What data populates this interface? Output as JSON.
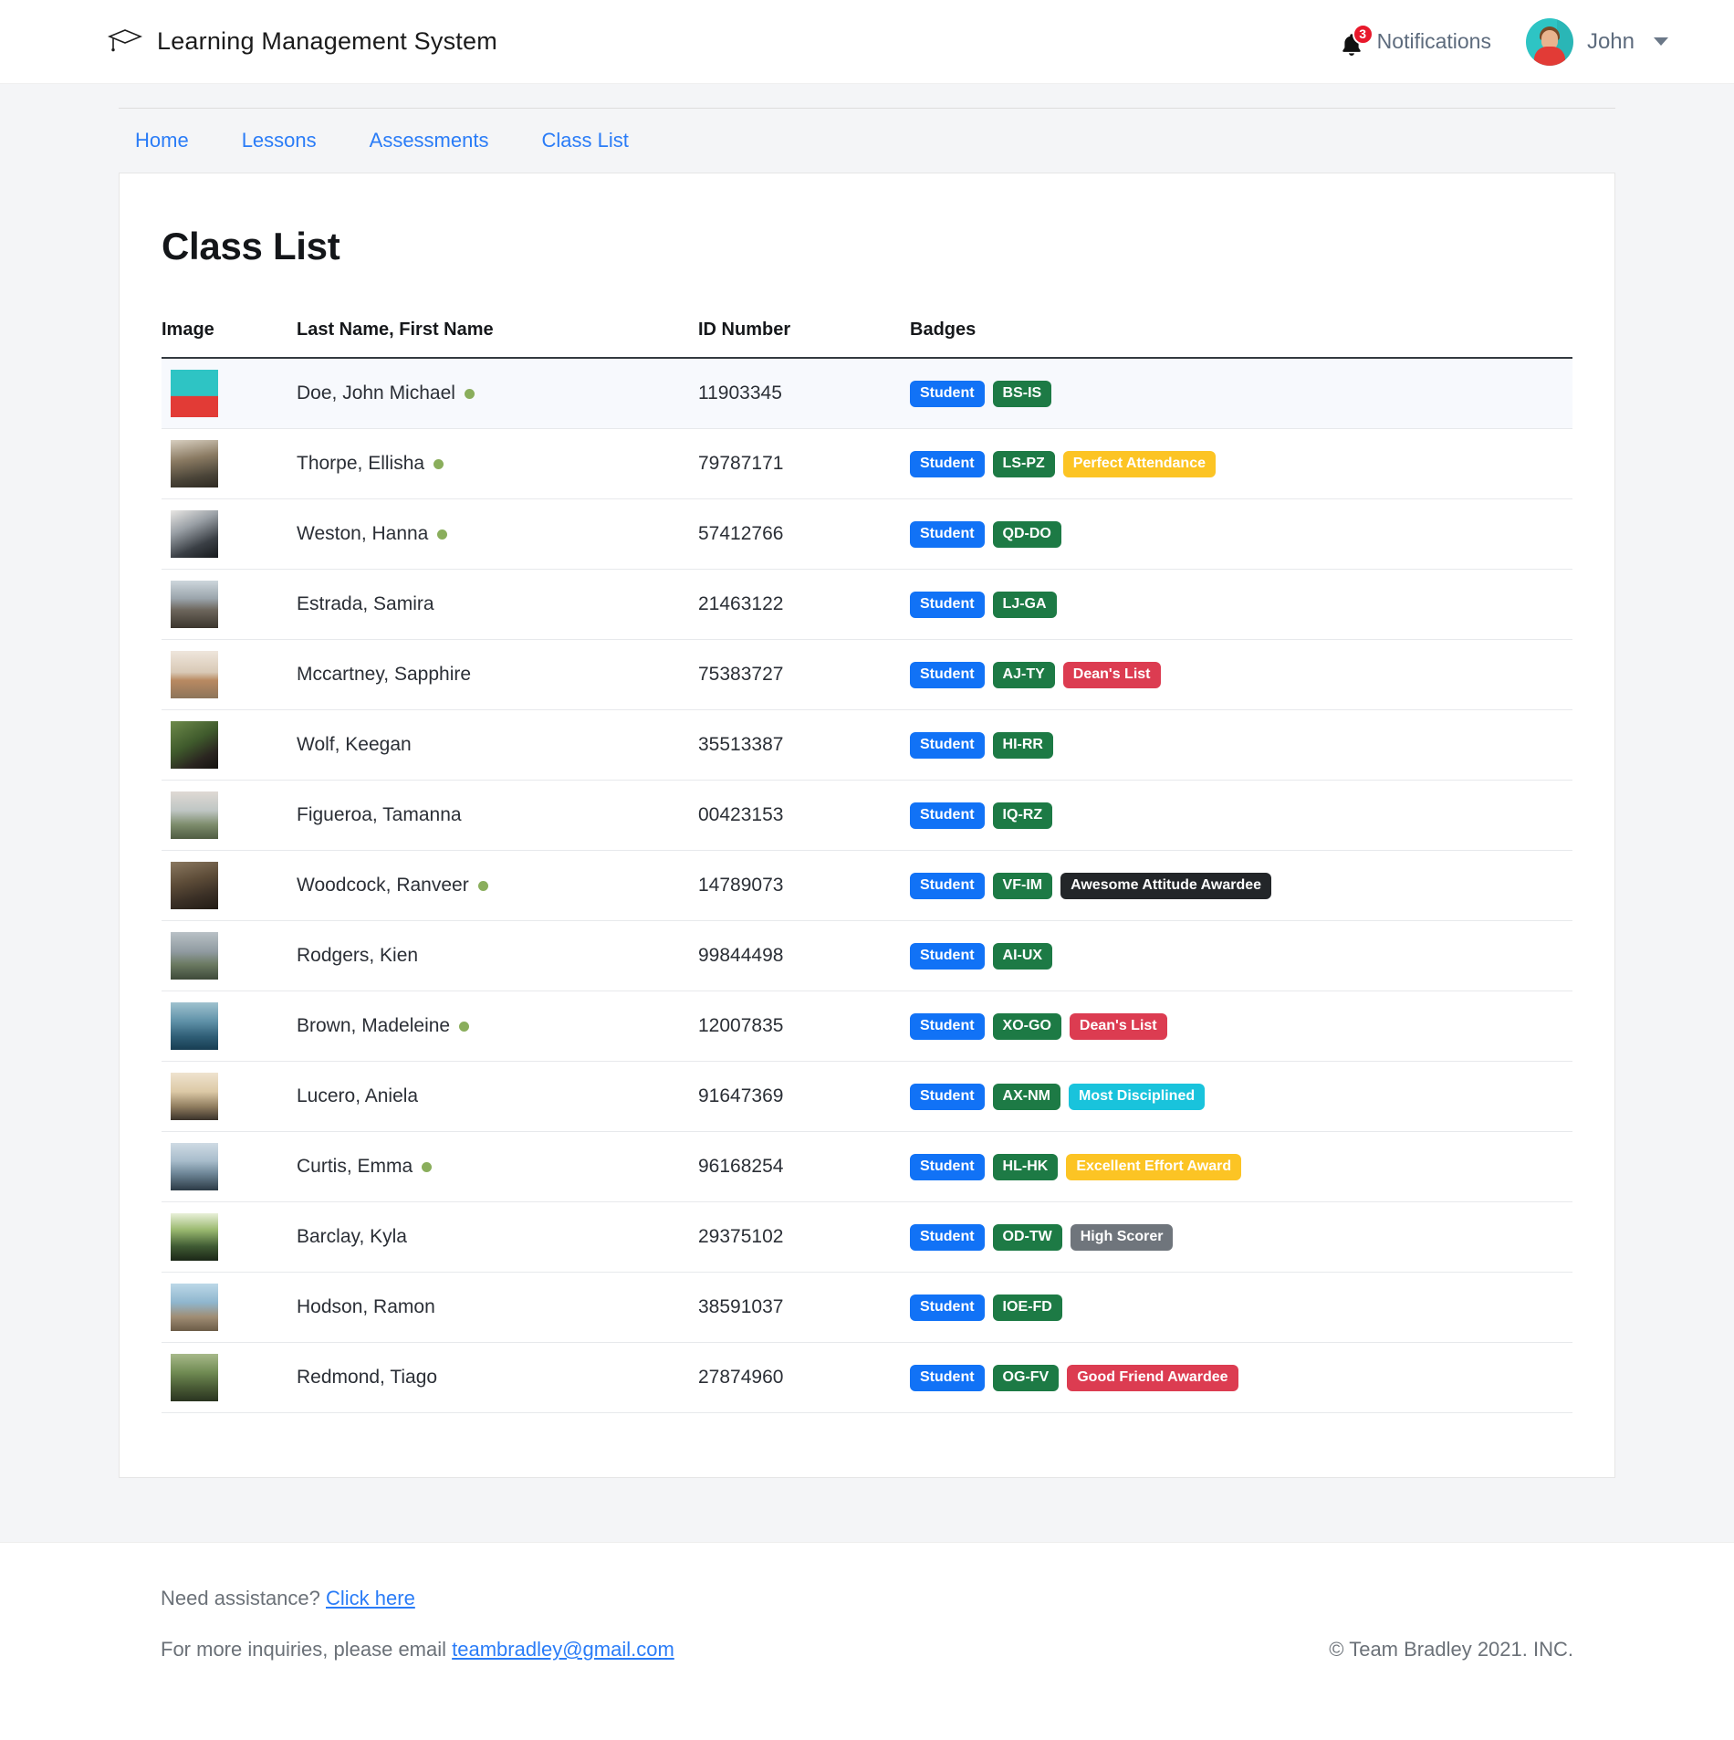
{
  "header": {
    "brand_title": "Learning Management System",
    "brand_icon": "graduation-cap-icon",
    "notifications": {
      "label": "Notifications",
      "count": "3",
      "icon": "bell-icon"
    },
    "user": {
      "name": "John",
      "avatar": "user-avatar",
      "caret": "chevron-down-icon"
    }
  },
  "subnav": {
    "items": [
      {
        "label": "Home"
      },
      {
        "label": "Lessons"
      },
      {
        "label": "Assessments"
      },
      {
        "label": "Class List"
      }
    ]
  },
  "main": {
    "page_title": "Class List",
    "table": {
      "columns": [
        "Image",
        "Last Name, First Name",
        "ID Number",
        "Badges"
      ],
      "rows": [
        {
          "name": "Doe, John Michael",
          "online": true,
          "id": "11903345",
          "highlight": true,
          "thumb": "avatar-john-thumb",
          "badges": [
            {
              "label": "Student",
              "color": "b-primary"
            },
            {
              "label": "BS-IS",
              "color": "b-green"
            }
          ]
        },
        {
          "name": "Thorpe, Ellisha",
          "online": true,
          "id": "79787171",
          "highlight": false,
          "thumb": "alleyway-thumb",
          "badges": [
            {
              "label": "Student",
              "color": "b-primary"
            },
            {
              "label": "LS-PZ",
              "color": "b-green"
            },
            {
              "label": "Perfect Attendance",
              "color": "b-yellow"
            }
          ]
        },
        {
          "name": "Weston, Hanna",
          "online": true,
          "id": "57412766",
          "highlight": false,
          "thumb": "laptop-thumb",
          "badges": [
            {
              "label": "Student",
              "color": "b-primary"
            },
            {
              "label": "QD-DO",
              "color": "b-green"
            }
          ]
        },
        {
          "name": "Estrada, Samira",
          "online": false,
          "id": "21463122",
          "highlight": false,
          "thumb": "legs-rocks-thumb",
          "badges": [
            {
              "label": "Student",
              "color": "b-primary"
            },
            {
              "label": "LJ-GA",
              "color": "b-green"
            }
          ]
        },
        {
          "name": "Mccartney, Sapphire",
          "online": false,
          "id": "75383727",
          "highlight": false,
          "thumb": "cow-field-thumb",
          "badges": [
            {
              "label": "Student",
              "color": "b-primary"
            },
            {
              "label": "AJ-TY",
              "color": "b-green"
            },
            {
              "label": "Dean's List",
              "color": "b-red"
            }
          ]
        },
        {
          "name": "Wolf, Keegan",
          "online": false,
          "id": "35513387",
          "highlight": false,
          "thumb": "forest-rock-thumb",
          "badges": [
            {
              "label": "Student",
              "color": "b-primary"
            },
            {
              "label": "HI-RR",
              "color": "b-green"
            }
          ]
        },
        {
          "name": "Figueroa, Tamanna",
          "online": false,
          "id": "00423153",
          "highlight": false,
          "thumb": "hill-dusk-thumb",
          "badges": [
            {
              "label": "Student",
              "color": "b-primary"
            },
            {
              "label": "IQ-RZ",
              "color": "b-green"
            }
          ]
        },
        {
          "name": "Woodcock, Ranveer",
          "online": true,
          "id": "14789073",
          "highlight": false,
          "thumb": "bear-thumb",
          "badges": [
            {
              "label": "Student",
              "color": "b-primary"
            },
            {
              "label": "VF-IM",
              "color": "b-green"
            },
            {
              "label": "Awesome Attitude Awardee",
              "color": "b-dark"
            }
          ]
        },
        {
          "name": "Rodgers, Kien",
          "online": false,
          "id": "99844498",
          "highlight": false,
          "thumb": "valley-thumb",
          "badges": [
            {
              "label": "Student",
              "color": "b-primary"
            },
            {
              "label": "AI-UX",
              "color": "b-green"
            }
          ]
        },
        {
          "name": "Brown, Madeleine",
          "online": true,
          "id": "12007835",
          "highlight": false,
          "thumb": "ocean-thumb",
          "badges": [
            {
              "label": "Student",
              "color": "b-primary"
            },
            {
              "label": "XO-GO",
              "color": "b-green"
            },
            {
              "label": "Dean's List",
              "color": "b-red"
            }
          ]
        },
        {
          "name": "Lucero, Aniela",
          "online": false,
          "id": "91647369",
          "highlight": false,
          "thumb": "clouds-sunset-thumb",
          "badges": [
            {
              "label": "Student",
              "color": "b-primary"
            },
            {
              "label": "AX-NM",
              "color": "b-green"
            },
            {
              "label": "Most Disciplined",
              "color": "b-cyan"
            }
          ]
        },
        {
          "name": "Curtis, Emma",
          "online": true,
          "id": "96168254",
          "highlight": false,
          "thumb": "cityscape-thumb",
          "badges": [
            {
              "label": "Student",
              "color": "b-primary"
            },
            {
              "label": "HL-HK",
              "color": "b-green"
            },
            {
              "label": "Excellent Effort Award",
              "color": "b-yellow"
            }
          ]
        },
        {
          "name": "Barclay, Kyla",
          "online": false,
          "id": "29375102",
          "highlight": false,
          "thumb": "forest-road-thumb",
          "badges": [
            {
              "label": "Student",
              "color": "b-primary"
            },
            {
              "label": "OD-TW",
              "color": "b-green"
            },
            {
              "label": "High Scorer",
              "color": "b-gray"
            }
          ]
        },
        {
          "name": "Hodson, Ramon",
          "online": false,
          "id": "38591037",
          "highlight": false,
          "thumb": "beach-walker-thumb",
          "badges": [
            {
              "label": "Student",
              "color": "b-primary"
            },
            {
              "label": "IOE-FD",
              "color": "b-green"
            }
          ]
        },
        {
          "name": "Redmond, Tiago",
          "online": false,
          "id": "27874960",
          "highlight": false,
          "thumb": "trail-thumb",
          "badges": [
            {
              "label": "Student",
              "color": "b-primary"
            },
            {
              "label": "OG-FV",
              "color": "b-green"
            },
            {
              "label": "Good Friend Awardee",
              "color": "b-red"
            }
          ]
        }
      ]
    }
  },
  "footer": {
    "assistance_text": "Need assistance? ",
    "assistance_link": "Click here",
    "inquiries_text": "For more inquiries, please email ",
    "inquiries_link": "teambradley@gmail.com",
    "copyright": "© Team Bradley 2021. INC."
  },
  "thumb_gradients": {
    "avatar-john-thumb": "linear-gradient(180deg,#2ec4c4 0%,#2ec4c4 55%,#e23b36 56%,#e23b36 100%)",
    "alleyway-thumb": "linear-gradient(170deg,#d8cfc0 0%,#8a7a62 40%,#4a4438 75%,#2e2a22 100%)",
    "laptop-thumb": "linear-gradient(155deg,#e9e7e4 0%,#9aa0a6 35%,#3a3f45 70%,#16191c 100%)",
    "legs-rocks-thumb": "linear-gradient(180deg,#cdd6dc 0%,#9aa4ab 38%,#6d665c 62%,#3b352d 100%)",
    "cow-field-thumb": "linear-gradient(180deg,#efe6dc 0%,#d8c9b6 45%,#b98a62 62%,#8d745a 100%)",
    "forest-rock-thumb": "linear-gradient(150deg,#6d8a4a 0%,#3f5a2c 45%,#2a2520 75%,#14120f 100%)",
    "hill-dusk-thumb": "linear-gradient(180deg,#dfd9d4 0%,#bfc6c4 40%,#7d8c6c 70%,#4f5c42 100%)",
    "bear-thumb": "linear-gradient(165deg,#8a7860 0%,#5d4c38 40%,#3b3026 70%,#221c15 100%)",
    "valley-thumb": "linear-gradient(180deg,#b9c1c6 0%,#8f9aa0 42%,#6b7a62 68%,#3e4a39 100%)",
    "ocean-thumb": "linear-gradient(180deg,#9fc2cf 0%,#5f91a8 40%,#2f5e76 72%,#173d52 100%)",
    "clouds-sunset-thumb": "linear-gradient(180deg,#efe3cf 0%,#dcc9a6 40%,#8f7c5e 72%,#3a322a 100%)",
    "cityscape-thumb": "linear-gradient(180deg,#cfdbe4 0%,#a7bccb 38%,#6d8596 65%,#2b3a45 100%)",
    "forest-road-thumb": "linear-gradient(180deg,#e9f0d9 0%,#9ab96f 35%,#3f5a33 70%,#1b2717 100%)",
    "beach-walker-thumb": "linear-gradient(180deg,#bcd8e8 0%,#8fb6ce 40%,#a08d74 70%,#6b5c47 100%)",
    "trail-thumb": "linear-gradient(180deg,#a7b98a 0%,#6f8a52 40%,#4a5c36 70%,#2a3420 100%)"
  }
}
